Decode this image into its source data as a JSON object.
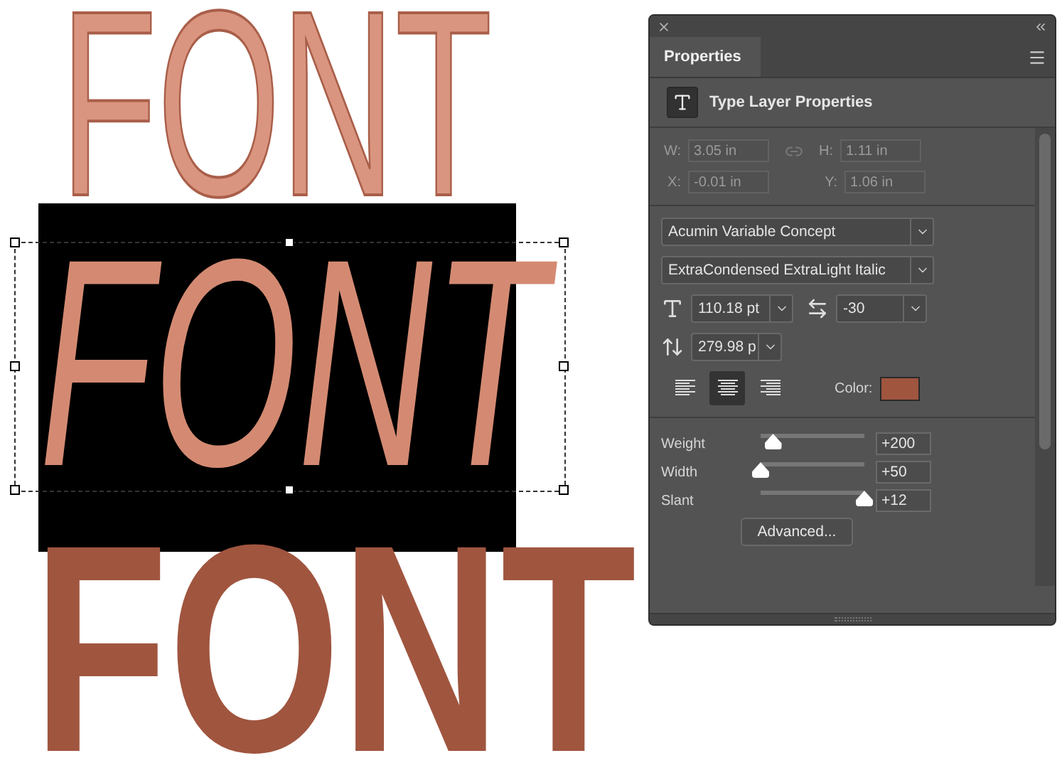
{
  "canvas": {
    "texts": [
      {
        "text": "FONT",
        "kind": "thin",
        "selected": false
      },
      {
        "text": "FONT",
        "kind": "italic",
        "selected": true
      },
      {
        "text": "FONT",
        "kind": "heavy",
        "selected": false
      }
    ]
  },
  "panel": {
    "tab": "Properties",
    "section_title": "Type Layer Properties",
    "transform": {
      "disabled": true,
      "w_label": "W:",
      "w": "3.05 in",
      "h_label": "H:",
      "h": "1.11 in",
      "x_label": "X:",
      "x": "-0.01 in",
      "y_label": "Y:",
      "y": "1.06 in"
    },
    "font_family": "Acumin Variable Concept",
    "font_style": "ExtraCondensed ExtraLight Italic",
    "font_size": "110.18 pt",
    "tracking": "-30",
    "leading": "279.98 p",
    "alignment": [
      {
        "kind": "left",
        "selected": false
      },
      {
        "kind": "center",
        "selected": true
      },
      {
        "kind": "right",
        "selected": false
      }
    ],
    "color_label": "Color:",
    "color": "#a0553f",
    "axes": [
      {
        "label": "Weight",
        "level": 0.12,
        "value": "+200"
      },
      {
        "label": "Width",
        "level": 0.0,
        "value": "+50"
      },
      {
        "label": "Slant",
        "level": 1.0,
        "value": "+12"
      }
    ],
    "advanced_button": "Advanced..."
  }
}
